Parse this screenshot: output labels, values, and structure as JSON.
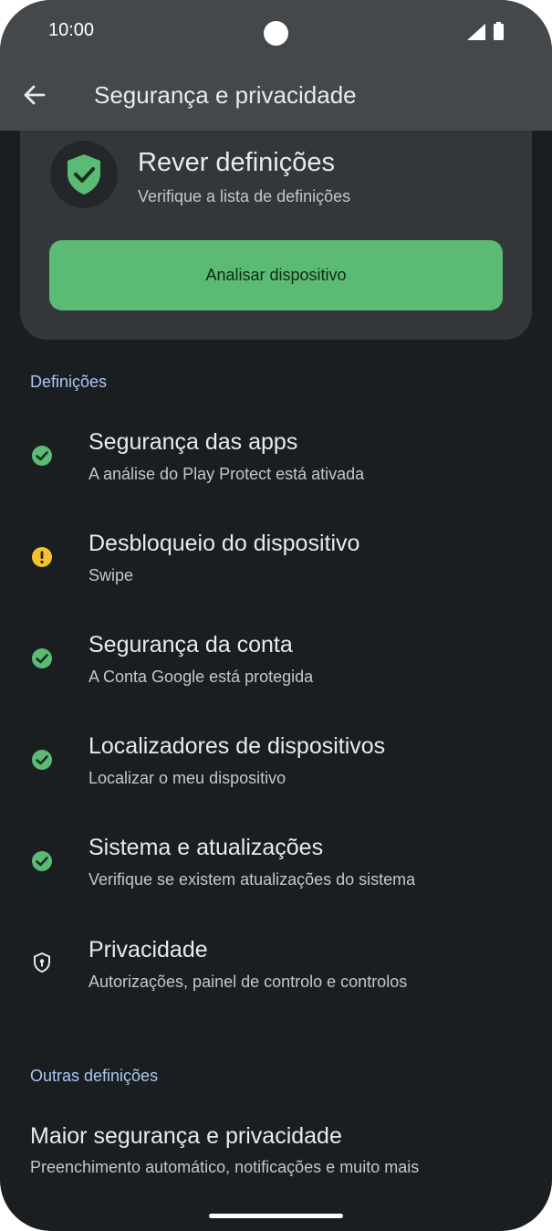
{
  "status_bar": {
    "time": "10:00"
  },
  "app_bar": {
    "title": "Segurança e privacidade"
  },
  "summary_card": {
    "title": "Rever definições",
    "subtitle": "Verifique a lista de definições",
    "button_label": "Analisar dispositivo"
  },
  "settings_section": {
    "header": "Definições",
    "items": [
      {
        "title": "Segurança das apps",
        "subtitle": "A análise do Play Protect está ativada",
        "status": "ok"
      },
      {
        "title": "Desbloqueio do dispositivo",
        "subtitle": "Swipe",
        "status": "warning"
      },
      {
        "title": "Segurança da conta",
        "subtitle": "A Conta Google está protegida",
        "status": "ok"
      },
      {
        "title": "Localizadores de dispositivos",
        "subtitle": "Localizar o meu dispositivo",
        "status": "ok"
      },
      {
        "title": "Sistema e atualizações",
        "subtitle": "Verifique se existem atualizações do sistema",
        "status": "ok"
      },
      {
        "title": "Privacidade",
        "subtitle": "Autorizações, painel de controlo e controlos",
        "status": "privacy"
      }
    ]
  },
  "other_section": {
    "header": "Outras definições",
    "item": {
      "title": "Maior segurança e privacidade",
      "subtitle": "Preenchimento automático, notificações e muito mais"
    }
  },
  "colors": {
    "background": "#1b1e21",
    "app_bar": "#45484b",
    "card": "#33373a",
    "accent_green": "#5bba73",
    "warning_yellow": "#f2c230",
    "section_header": "#a8c8f0"
  },
  "icons": {
    "back": "arrow-left-icon",
    "card": "shield-check-icon",
    "ok": "check-circle-icon",
    "warning": "alert-circle-icon",
    "privacy": "shield-lock-icon"
  }
}
